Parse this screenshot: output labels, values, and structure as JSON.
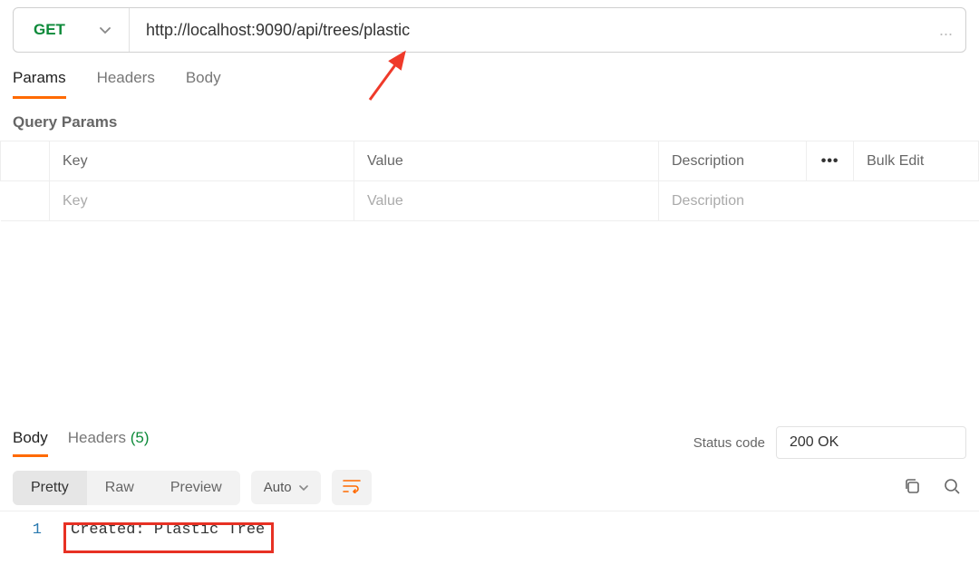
{
  "request": {
    "method": "GET",
    "url": "http://localhost:9090/api/trees/plastic",
    "url_truncation": "..."
  },
  "request_tabs": {
    "items": [
      {
        "label": "Params",
        "active": true
      },
      {
        "label": "Headers",
        "active": false
      },
      {
        "label": "Body",
        "active": false
      }
    ]
  },
  "query_params": {
    "section_label": "Query Params",
    "headers": {
      "key": "Key",
      "value": "Value",
      "description": "Description",
      "bulk": "Bulk Edit"
    },
    "placeholders": {
      "key": "Key",
      "value": "Value",
      "description": "Description"
    },
    "rows": [
      {
        "key": "",
        "value": "",
        "description": ""
      }
    ]
  },
  "response": {
    "tabs": {
      "body": "Body",
      "headers_label": "Headers",
      "headers_count": "(5)"
    },
    "status": {
      "label": "Status code",
      "value": "200 OK"
    },
    "view_modes": {
      "pretty": "Pretty",
      "raw": "Raw",
      "preview": "Preview"
    },
    "format_mode": "Auto",
    "body_lines": [
      "Created: Plastic Tree"
    ]
  }
}
